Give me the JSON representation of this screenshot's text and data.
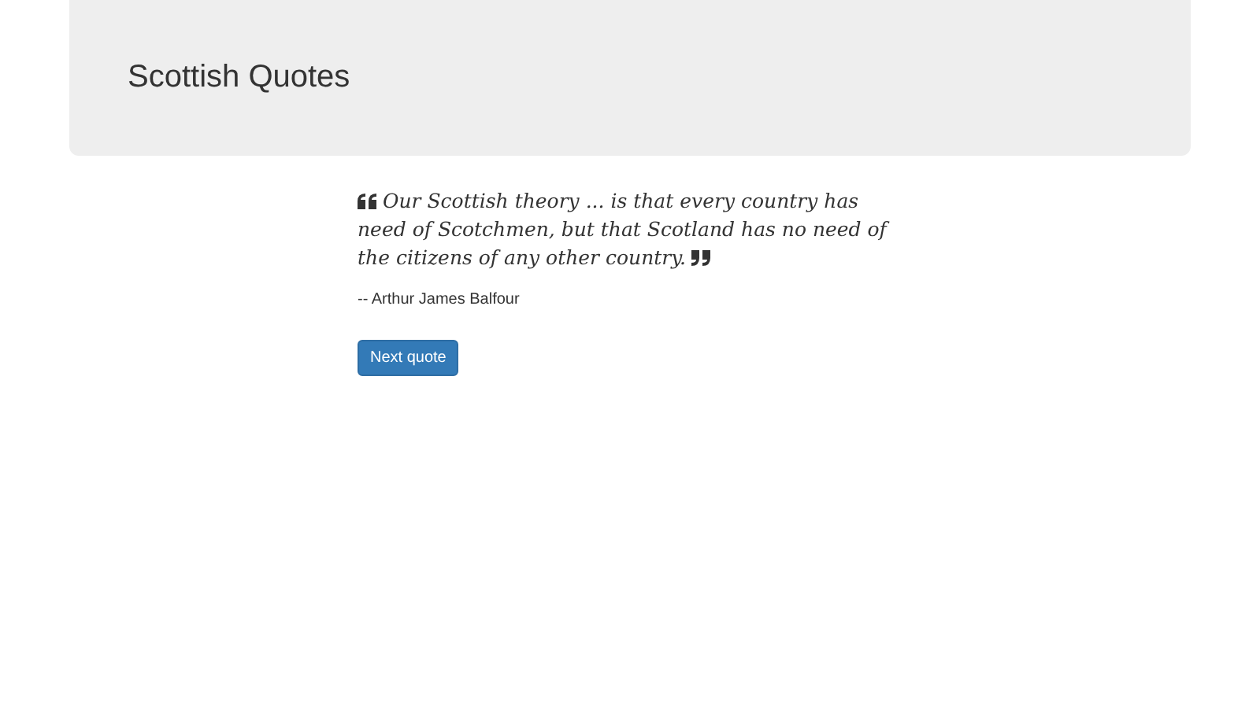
{
  "header": {
    "title": "Scottish Quotes"
  },
  "quote": {
    "text": "Our Scottish theory ... is that every country has need of Scotchmen, but that Scotland has no need of the citizens of any other country.",
    "author": "-- Arthur James Balfour"
  },
  "buttons": [
    "Next quote"
  ]
}
